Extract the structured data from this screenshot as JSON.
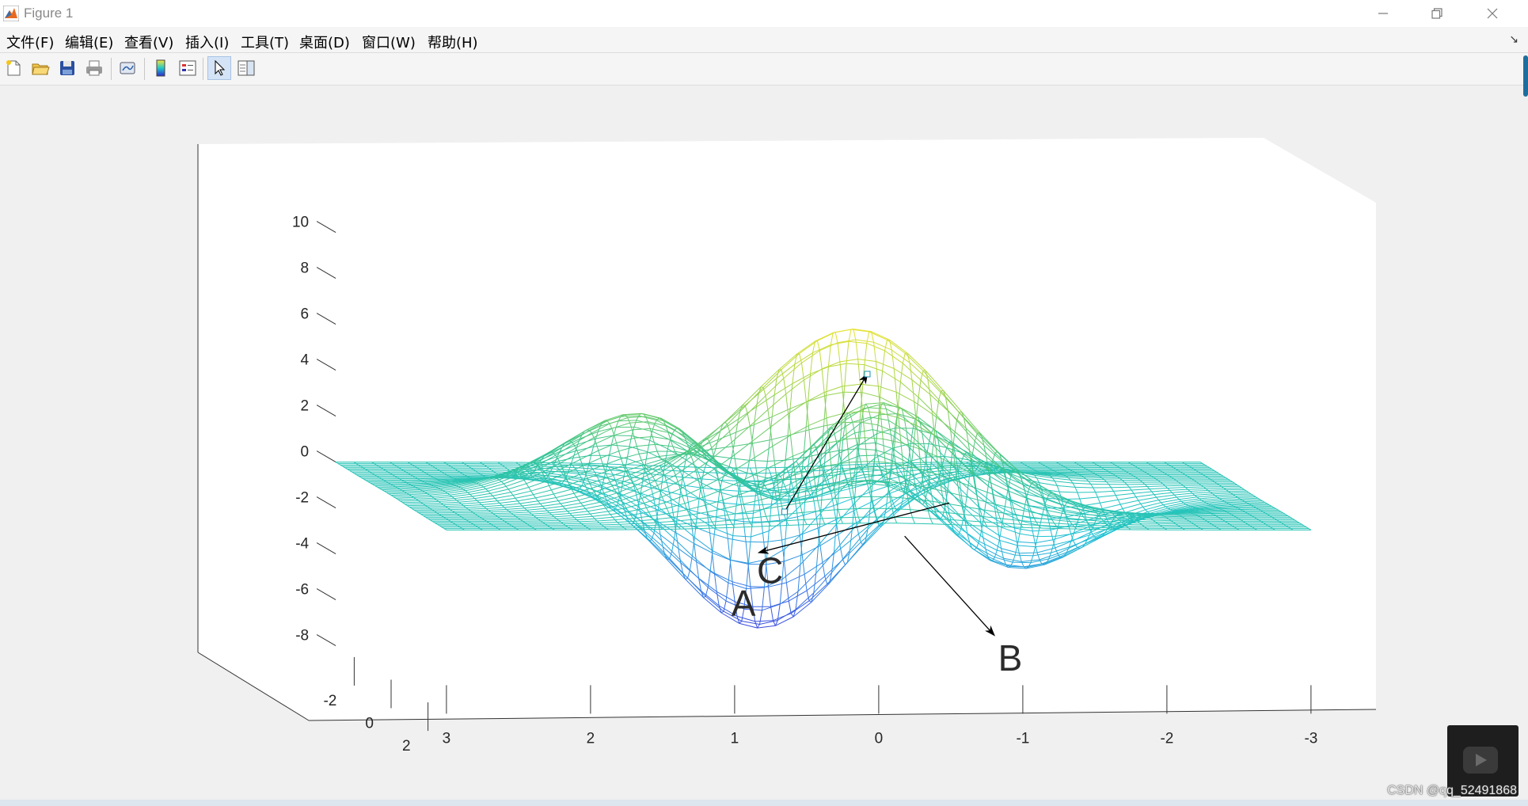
{
  "window": {
    "title": "Figure 1",
    "minimize_icon": "minimize-icon",
    "maximize_icon": "restore-icon",
    "close_icon": "close-icon"
  },
  "menu": {
    "items": [
      "文件(F)",
      "编辑(E)",
      "查看(V)",
      "插入(I)",
      "工具(T)",
      "桌面(D)",
      "窗口(W)",
      "帮助(H)"
    ],
    "dock_glyph": "↘"
  },
  "toolbar": {
    "buttons": [
      {
        "name": "new-figure-icon"
      },
      {
        "name": "open-file-icon"
      },
      {
        "name": "save-icon"
      },
      {
        "name": "print-icon"
      },
      {
        "name": "link-plot-icon"
      },
      {
        "name": "colorbar-icon"
      },
      {
        "name": "legend-icon"
      },
      {
        "name": "edit-plot-pointer-icon",
        "active": true
      },
      {
        "name": "property-inspector-icon"
      }
    ]
  },
  "chart_data": {
    "type": "surface-mesh",
    "z_ticks": [
      "10",
      "8",
      "6",
      "4",
      "2",
      "0",
      "-2",
      "-4",
      "-6",
      "-8"
    ],
    "y_ticks": [
      "-2",
      "0",
      "2"
    ],
    "x_ticks": [
      "3",
      "2",
      "1",
      "0",
      "-1",
      "-2",
      "-3"
    ],
    "xlim": [
      -3,
      3
    ],
    "ylim": [
      -3,
      3
    ],
    "zlim": [
      -8,
      10
    ],
    "colormap": [
      "#3c21d8",
      "#3a7ee6",
      "#1ec4d4",
      "#38c490",
      "#9dd34c",
      "#f2e52c"
    ],
    "annotations": [
      {
        "label": "A",
        "arrow_from": [
          -0.9,
          -0.2,
          -0.4
        ],
        "arrow_to": [
          0.28,
          -1.3,
          -3.1
        ]
      },
      {
        "label": "B",
        "arrow_from": [
          -0.5,
          0.5,
          -1.5
        ],
        "arrow_to": [
          -1.3,
          -0.9,
          -6.5
        ]
      },
      {
        "label": "C",
        "arrow_from": [
          0.5,
          1.8,
          0.2
        ],
        "arrow_to": [
          -0.1,
          1.6,
          6.1
        ]
      }
    ]
  },
  "watermark": "CSDN @qq_52491868",
  "overlay": {
    "play_icon": "video-play-icon"
  }
}
